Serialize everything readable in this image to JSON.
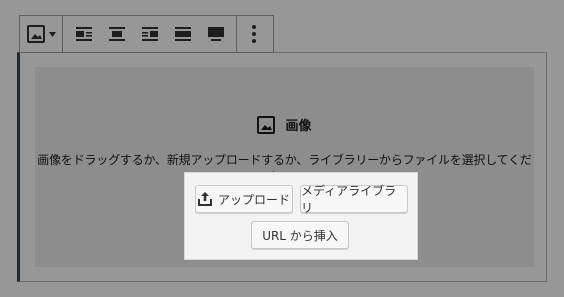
{
  "toolbar": {
    "image_type_button": {
      "icon": "image-icon",
      "dropdown_icon": "caret-down-icon"
    },
    "alignment_buttons": [
      {
        "icon": "align-left-icon"
      },
      {
        "icon": "align-center-icon"
      },
      {
        "icon": "align-right-icon"
      },
      {
        "icon": "align-wide-icon"
      },
      {
        "icon": "align-full-icon"
      }
    ],
    "more_options_icon": "vertical-ellipsis-icon"
  },
  "placeholder": {
    "title": "画像",
    "title_icon": "image-icon",
    "instructions": "画像をドラッグするか、新規アップロードするか、ライブラリーからファイルを選択してください。",
    "buttons": {
      "upload_label": "アップロード",
      "upload_icon": "upload-icon",
      "media_library_label": "メディアライブラリ",
      "insert_url_label": "URL から挿入"
    }
  },
  "colors": {
    "background": "#979797",
    "placeholder_background": "#8d8d8d",
    "button_panel": "#f3f3f3",
    "accent_border": "#1d2a3a"
  }
}
